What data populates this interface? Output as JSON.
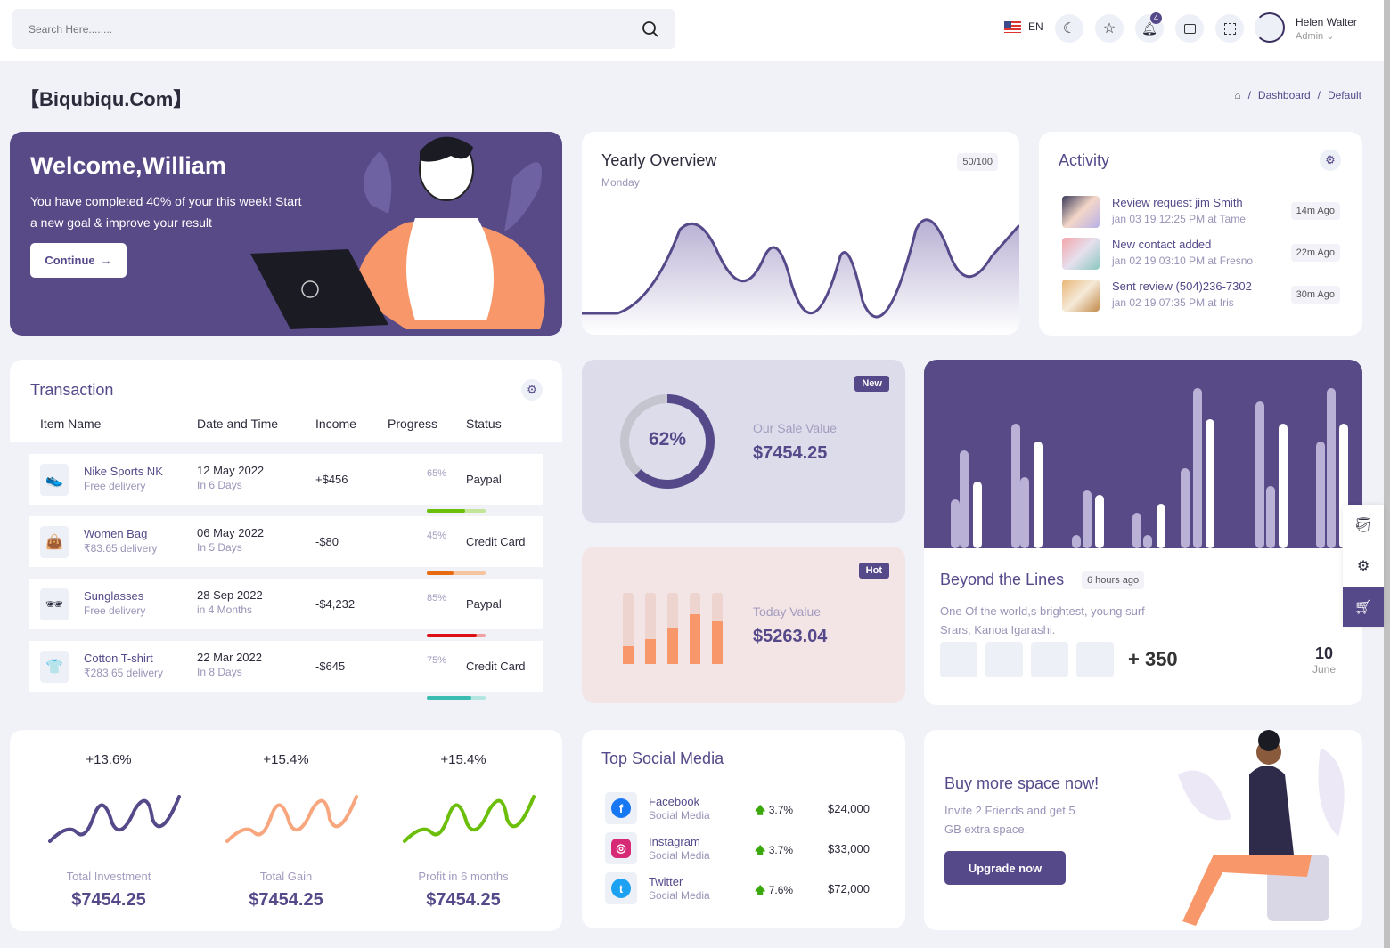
{
  "header": {
    "search_placeholder": "Search Here........",
    "lang": "EN",
    "notif_count": "4",
    "user_name": "Helen Walter",
    "user_role": "Admin"
  },
  "page": {
    "title": "【Biqubiqu.Com】",
    "breadcrumb": [
      "Dashboard",
      "Default"
    ]
  },
  "welcome": {
    "title": "Welcome,William",
    "text1": "You have completed 40% of your this week! Start",
    "text2": "a new goal & improve your result",
    "button": "Continue"
  },
  "yearly": {
    "title": "Yearly Overview",
    "subtitle": "Monday",
    "badge": "50/100"
  },
  "activity": {
    "title": "Activity",
    "items": [
      {
        "title": "Review request jim Smith",
        "sub": "jan 03 19 12:25 PM at Tame",
        "time": "14m Ago"
      },
      {
        "title": "New contact added",
        "sub": "jan 02 19 03:10 PM at Fresno",
        "time": "22m Ago"
      },
      {
        "title": "Sent review (504)236-7302",
        "sub": "jan 02 19 07:35 PM at Iris",
        "time": "30m Ago"
      }
    ]
  },
  "transaction": {
    "title": "Transaction",
    "columns": [
      "Item Name",
      "Date and Time",
      "Income",
      "Progress",
      "Status"
    ],
    "rows": [
      {
        "icon": "👟",
        "name": "Nike Sports NK",
        "sub": "Free delivery",
        "date": "12 May 2022",
        "due": "In 6 Days",
        "income": "+$456",
        "progress": 65,
        "progress_label": "65%",
        "color": "#6bbf0a",
        "track": "#c2e59a",
        "status": "Paypal"
      },
      {
        "icon": "👜",
        "name": "Women Bag",
        "sub": "₹83.65 delivery",
        "date": "06 May 2022",
        "due": "In 5 Days",
        "income": "-$80",
        "progress": 45,
        "progress_label": "45%",
        "color": "#e86a10",
        "track": "#f6c49e",
        "status": "Credit Card"
      },
      {
        "icon": "🕶",
        "name": "Sunglasses",
        "sub": "Free delivery",
        "date": "28 Sep 2022",
        "due": "in 4 Months",
        "income": "-$4,232",
        "progress": 85,
        "progress_label": "85%",
        "color": "#dc0f14",
        "track": "#f0a0a2",
        "status": "Paypal"
      },
      {
        "icon": "👕",
        "name": "Cotton T-shirt",
        "sub": "₹283.65 delivery",
        "date": "22 Mar 2022",
        "due": "In 8 Days",
        "income": "-$645",
        "progress": 75,
        "progress_label": "75%",
        "color": "#3bbcb0",
        "track": "#b3e6e1",
        "status": "Credit Card"
      }
    ]
  },
  "sale": {
    "percent": 62,
    "percent_label": "62%",
    "badge": "New",
    "label": "Our Sale Value",
    "value": "$7454.25"
  },
  "today": {
    "badge": "Hot",
    "label": "Today Value",
    "value": "$5263.04",
    "bars": [
      25,
      35,
      50,
      70,
      60
    ]
  },
  "beyond": {
    "title": "Beyond the Lines",
    "badge": "6 hours ago",
    "text1": "One Of the world,s brightest, young surf",
    "text2": "Srars, Kanoa Igarashi.",
    "count": "+ 350",
    "day": "10",
    "month": "June"
  },
  "stats": [
    {
      "change": "+13.6%",
      "label": "Total Investment",
      "value": "$7454.25",
      "color": "#56498a"
    },
    {
      "change": "+15.4%",
      "label": "Total Gain",
      "value": "$7454.25",
      "color": "#f8a67e"
    },
    {
      "change": "+15.4%",
      "label": "Profit in 6 months",
      "value": "$7454.25",
      "color": "#6bbf0a"
    }
  ],
  "social": {
    "title": "Top Social Media",
    "items": [
      {
        "name": "Facebook",
        "sub": "Social Media",
        "change": "3.7%",
        "amount": "$24,000",
        "icon": "facebook-icon"
      },
      {
        "name": "Instagram",
        "sub": "Social Media",
        "change": "3.7%",
        "amount": "$33,000",
        "icon": "instagram-icon"
      },
      {
        "name": "Twitter",
        "sub": "Social Media",
        "change": "7.6%",
        "amount": "$72,000",
        "icon": "twitter-icon"
      }
    ]
  },
  "promo": {
    "title": "Buy more space now!",
    "text1": "Invite 2 Friends and get 5",
    "text2": "GB extra space.",
    "button": "Upgrade now"
  },
  "colors": {
    "primary": "#56498a",
    "bg": "#f0f2f8"
  }
}
